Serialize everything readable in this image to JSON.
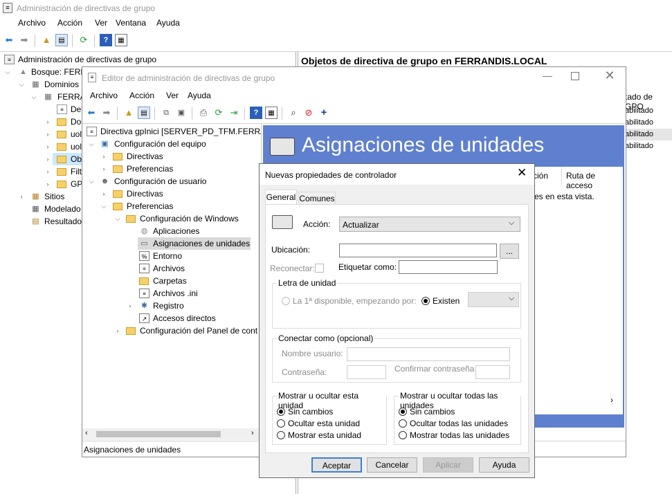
{
  "main_window": {
    "title": "Administración de directivas de grupo",
    "menu": [
      "Archivo",
      "Acción",
      "Ver",
      "Ventana",
      "Ayuda"
    ],
    "tree": {
      "root": "Administración de directivas de grupo",
      "forest": "Bosque: FERRA",
      "domains": "Dominios",
      "domain": "FERRAI",
      "child_def": "Def",
      "child_do": "Do",
      "child_uo1": "uol",
      "child_uo2": "uol",
      "child_obj": "Ob",
      "child_filt": "Filt",
      "child_gpo": "GPO",
      "sites": "Sitios",
      "modeling": "Modelado",
      "results": "Resultados"
    },
    "right_header": "Objetos de directiva de grupo en FERRANDIS.LOCAL",
    "right_col": "tado de GPO",
    "right_rows": [
      "abilitado",
      "abilitado",
      "abilitado",
      "abilitado"
    ]
  },
  "editor": {
    "title": "Editor de administración de directivas de grupo",
    "menu": [
      "Archivo",
      "Acción",
      "Ver",
      "Ayuda"
    ],
    "tree": {
      "root": "Directiva gpInici [SERVER_PD_TFM.FERRANI",
      "computer_config": "Configuración del equipo",
      "c_directivas": "Directivas",
      "c_preferencias": "Preferencias",
      "user_config": "Configuración de usuario",
      "u_directivas": "Directivas",
      "u_preferencias": "Preferencias",
      "win_config": "Configuración de Windows",
      "apps": "Aplicaciones",
      "drive_maps": "Asignaciones de unidades",
      "environment": "Entorno",
      "files": "Archivos",
      "folders": "Carpetas",
      "ini_files": "Archivos .ini",
      "registry": "Registro",
      "shortcuts": "Accesos directos",
      "control_panel": "Configuración del Panel de cont"
    },
    "banner": "Asignaciones de unidades",
    "cols": [
      "ción",
      "Ruta de acceso"
    ],
    "empty_msg": "es en esta vista.",
    "status": "Asignaciones de unidades"
  },
  "dialog": {
    "title": "Nuevas propiedades de controlador",
    "tabs": [
      "General",
      "Comunes"
    ],
    "action_label": "Acción:",
    "action_value": "Actualizar",
    "location_label": "Ubicación:",
    "browse_label": "...",
    "reconnect_label": "Reconectar:",
    "label_as": "Etiquetar como:",
    "drive_letter_group": "Letra de unidad",
    "first_available": "La 1ª disponible, empezando por:",
    "existing": "Existen",
    "connect_as_group": "Conectar como (opcional)",
    "username_label": "Nombre usuario:",
    "password_label": "Contraseña:",
    "confirm_password_label": "Confirmar contraseña",
    "show_hide_drive_group": "Mostrar u ocultar esta unidad",
    "show_hide_drive_opts": [
      "Sin cambios",
      "Ocultar esta unidad",
      "Mostrar esta unidad"
    ],
    "show_hide_all_group": "Mostrar u ocultar todas las unidades",
    "show_hide_all_opts": [
      "Sin cambios",
      "Ocultar todas las unidades",
      "Mostrar todas las unidades"
    ],
    "buttons": {
      "ok": "Aceptar",
      "cancel": "Cancelar",
      "apply": "Aplicar",
      "help": "Ayuda"
    }
  }
}
